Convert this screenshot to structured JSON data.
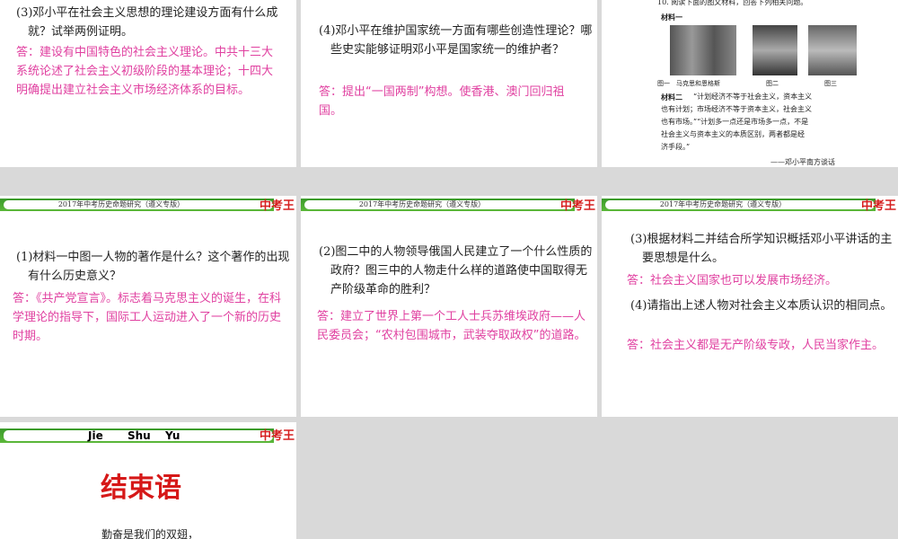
{
  "banner_title": "2017年中考历史命题研究（遵义专版）",
  "banner_logo": "中考王",
  "s1": {
    "question": "(3)邓小平在社会主义思想的理论建设方面有什么成就？试举两例证明。",
    "answer": "答：建设有中国特色的社会主义理论。中共十三大系统论述了社会主义初级阶段的基本理论；十四大明确提出建立社会主义市场经济体系的目标。"
  },
  "s2": {
    "question": "(4)邓小平在维护国家统一方面有哪些创造性理论？哪些史实能够证明邓小平是国家统一的维护者？",
    "answer": "答：提出“一国两制”构想。使香港、澳门回归祖国。"
  },
  "s3": {
    "top": "10. 阅读下面的图文材料，回答下列相关问题。",
    "m1": "材料一",
    "cap1": "图一　马克思和恩格斯",
    "cap2": "图二",
    "cap3": "图三",
    "m2_label": "材料二",
    "m2_lines": [
      "“计划经济不等于社会主义，资本主义",
      "也有计划；市场经济不等于资本主义，社会主义",
      "也有市场。”“计划多一点还是市场多一点，不是",
      "社会主义与资本主义的本质区别，两者都是经",
      "济手段。”"
    ],
    "source": "——邓小平南方谈话"
  },
  "s4": {
    "question": "(1)材料一中图一人物的著作是什么？这个著作的出现有什么历史意义？",
    "answer": "答：《共产党宣言》。标志着马克思主义的诞生，在科学理论的指导下，国际工人运动进入了一个新的历史时期。"
  },
  "s5": {
    "question": "(2)图二中的人物领导俄国人民建立了一个什么性质的政府？图三中的人物走什么样的道路使中国取得无产阶级革命的胜利？",
    "answer": "答：建立了世界上第一个工人士兵苏维埃政府——人民委员会；“农村包围城市，武装夺取政权”的道路。"
  },
  "s6": {
    "q3": "(3)根据材料二并结合所学知识概括邓小平讲话的主要思想是什么。",
    "a3": "答：社会主义国家也可以发展市场经济。",
    "q4": "(4)请指出上述人物对社会主义本质认识的相同点。",
    "a4": "答：社会主义都是无产阶级专政，人民当家作主。"
  },
  "s7": {
    "pinyin": [
      "Jie",
      "Shu",
      "Yu"
    ],
    "title": "结束语",
    "line1": "勤奋是我们的双翅，"
  }
}
